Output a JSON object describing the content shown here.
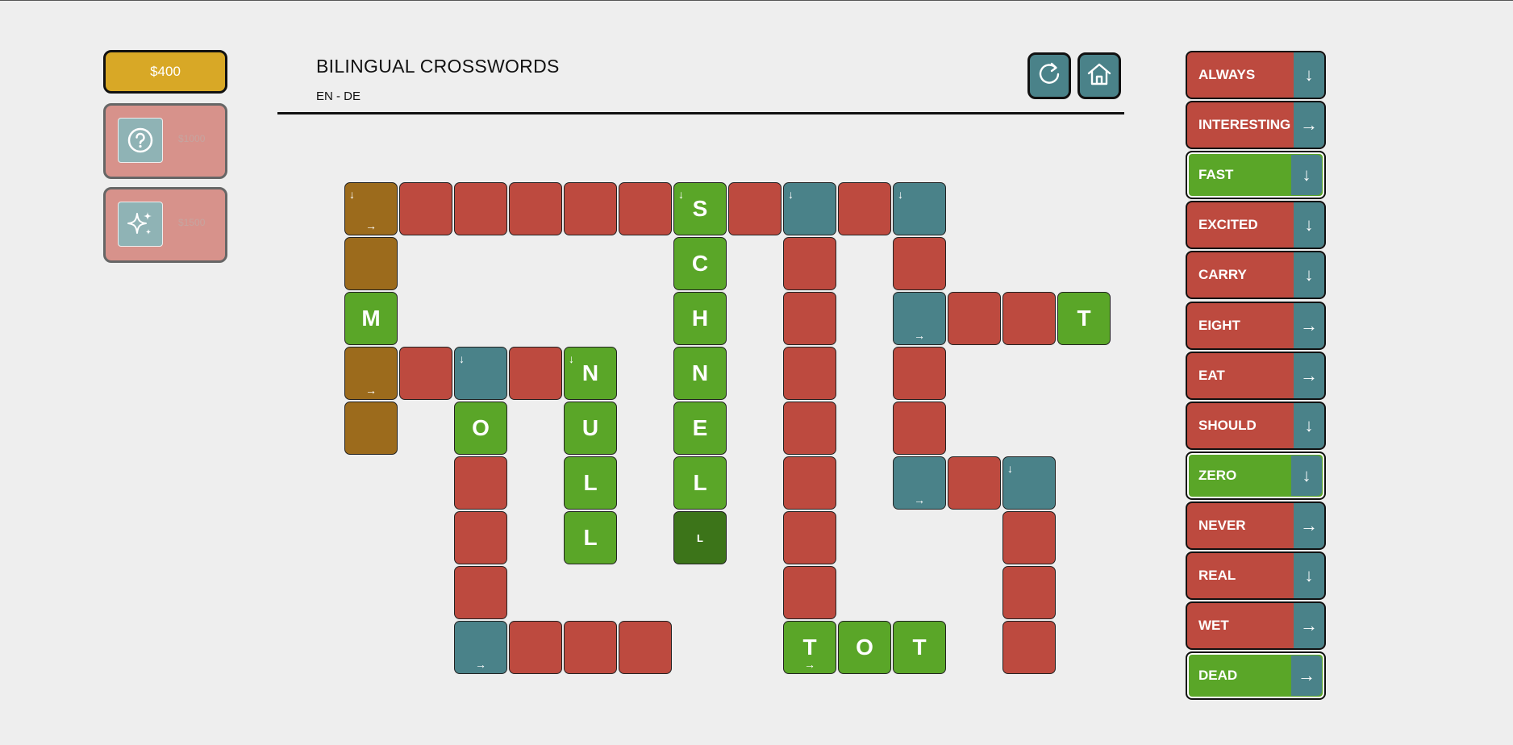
{
  "header": {
    "title": "BILINGUAL CROSSWORDS",
    "subtitle": "EN - DE"
  },
  "money": {
    "label": "$400"
  },
  "powerups": [
    {
      "icon": "help-circle-icon",
      "cost": "$1000"
    },
    {
      "icon": "sparkle-icon",
      "cost": "$1500"
    }
  ],
  "toolbar": {
    "restart_icon": "refresh-icon",
    "home_icon": "home-icon"
  },
  "colors": {
    "empty": "#bd4a3f",
    "correct": "#5aa628",
    "correct_dark": "#3c7419",
    "start": "#4a8289",
    "active": "#9c6b1c",
    "money": "#d8a826"
  },
  "grid": {
    "cells": [
      {
        "c": 0,
        "r": 0,
        "s": "active",
        "l": "",
        "d": true,
        "a": true
      },
      {
        "c": 1,
        "r": 0,
        "s": "empty",
        "l": ""
      },
      {
        "c": 2,
        "r": 0,
        "s": "empty",
        "l": ""
      },
      {
        "c": 3,
        "r": 0,
        "s": "empty",
        "l": ""
      },
      {
        "c": 4,
        "r": 0,
        "s": "empty",
        "l": ""
      },
      {
        "c": 5,
        "r": 0,
        "s": "empty",
        "l": ""
      },
      {
        "c": 6,
        "r": 0,
        "s": "correct",
        "l": "S",
        "d": true
      },
      {
        "c": 7,
        "r": 0,
        "s": "empty",
        "l": ""
      },
      {
        "c": 8,
        "r": 0,
        "s": "start",
        "l": "",
        "d": true
      },
      {
        "c": 9,
        "r": 0,
        "s": "empty",
        "l": ""
      },
      {
        "c": 10,
        "r": 0,
        "s": "start",
        "l": "",
        "d": true
      },
      {
        "c": 0,
        "r": 1,
        "s": "active",
        "l": ""
      },
      {
        "c": 6,
        "r": 1,
        "s": "correct",
        "l": "C"
      },
      {
        "c": 8,
        "r": 1,
        "s": "empty",
        "l": ""
      },
      {
        "c": 10,
        "r": 1,
        "s": "empty",
        "l": ""
      },
      {
        "c": 0,
        "r": 2,
        "s": "correct",
        "l": "M"
      },
      {
        "c": 6,
        "r": 2,
        "s": "correct",
        "l": "H"
      },
      {
        "c": 8,
        "r": 2,
        "s": "empty",
        "l": ""
      },
      {
        "c": 10,
        "r": 2,
        "s": "start",
        "l": "",
        "a": true
      },
      {
        "c": 11,
        "r": 2,
        "s": "empty",
        "l": ""
      },
      {
        "c": 12,
        "r": 2,
        "s": "empty",
        "l": ""
      },
      {
        "c": 13,
        "r": 2,
        "s": "correct",
        "l": "T"
      },
      {
        "c": 0,
        "r": 3,
        "s": "active",
        "l": "",
        "a": true
      },
      {
        "c": 1,
        "r": 3,
        "s": "empty",
        "l": ""
      },
      {
        "c": 2,
        "r": 3,
        "s": "start",
        "l": "",
        "d": true
      },
      {
        "c": 3,
        "r": 3,
        "s": "empty",
        "l": ""
      },
      {
        "c": 4,
        "r": 3,
        "s": "correct",
        "l": "N",
        "d": true
      },
      {
        "c": 6,
        "r": 3,
        "s": "correct",
        "l": "N"
      },
      {
        "c": 8,
        "r": 3,
        "s": "empty",
        "l": ""
      },
      {
        "c": 10,
        "r": 3,
        "s": "empty",
        "l": ""
      },
      {
        "c": 0,
        "r": 4,
        "s": "active",
        "l": ""
      },
      {
        "c": 2,
        "r": 4,
        "s": "correct",
        "l": "O"
      },
      {
        "c": 4,
        "r": 4,
        "s": "correct",
        "l": "U"
      },
      {
        "c": 6,
        "r": 4,
        "s": "correct",
        "l": "E"
      },
      {
        "c": 8,
        "r": 4,
        "s": "empty",
        "l": ""
      },
      {
        "c": 10,
        "r": 4,
        "s": "empty",
        "l": ""
      },
      {
        "c": 2,
        "r": 5,
        "s": "empty",
        "l": ""
      },
      {
        "c": 4,
        "r": 5,
        "s": "correct",
        "l": "L"
      },
      {
        "c": 6,
        "r": 5,
        "s": "correct",
        "l": "L"
      },
      {
        "c": 8,
        "r": 5,
        "s": "empty",
        "l": ""
      },
      {
        "c": 10,
        "r": 5,
        "s": "start",
        "l": "",
        "a": true
      },
      {
        "c": 11,
        "r": 5,
        "s": "empty",
        "l": ""
      },
      {
        "c": 12,
        "r": 5,
        "s": "start",
        "l": "",
        "d": true
      },
      {
        "c": 2,
        "r": 6,
        "s": "empty",
        "l": ""
      },
      {
        "c": 4,
        "r": 6,
        "s": "correct",
        "l": "L"
      },
      {
        "c": 6,
        "r": 6,
        "s": "correct_dark",
        "l": "L",
        "small": true
      },
      {
        "c": 8,
        "r": 6,
        "s": "empty",
        "l": ""
      },
      {
        "c": 12,
        "r": 6,
        "s": "empty",
        "l": ""
      },
      {
        "c": 2,
        "r": 7,
        "s": "empty",
        "l": ""
      },
      {
        "c": 8,
        "r": 7,
        "s": "empty",
        "l": ""
      },
      {
        "c": 12,
        "r": 7,
        "s": "empty",
        "l": ""
      },
      {
        "c": 2,
        "r": 8,
        "s": "start",
        "l": "",
        "a": true
      },
      {
        "c": 3,
        "r": 8,
        "s": "empty",
        "l": ""
      },
      {
        "c": 4,
        "r": 8,
        "s": "empty",
        "l": ""
      },
      {
        "c": 5,
        "r": 8,
        "s": "empty",
        "l": ""
      },
      {
        "c": 8,
        "r": 8,
        "s": "correct",
        "l": "T",
        "a": true
      },
      {
        "c": 9,
        "r": 8,
        "s": "correct",
        "l": "O"
      },
      {
        "c": 10,
        "r": 8,
        "s": "correct",
        "l": "T"
      },
      {
        "c": 12,
        "r": 8,
        "s": "empty",
        "l": ""
      }
    ]
  },
  "clues": [
    {
      "label": "ALWAYS",
      "dir": "↓",
      "state": "empty"
    },
    {
      "label": "INTERESTING",
      "dir": "→",
      "state": "empty"
    },
    {
      "label": "FAST",
      "dir": "↓",
      "state": "solved"
    },
    {
      "label": "EXCITED",
      "dir": "↓",
      "state": "empty"
    },
    {
      "label": "CARRY",
      "dir": "↓",
      "state": "empty"
    },
    {
      "label": "EIGHT",
      "dir": "→",
      "state": "empty"
    },
    {
      "label": "EAT",
      "dir": "→",
      "state": "empty"
    },
    {
      "label": "SHOULD",
      "dir": "↓",
      "state": "empty"
    },
    {
      "label": "ZERO",
      "dir": "↓",
      "state": "solved"
    },
    {
      "label": "NEVER",
      "dir": "→",
      "state": "empty"
    },
    {
      "label": "REAL",
      "dir": "↓",
      "state": "empty"
    },
    {
      "label": "WET",
      "dir": "→",
      "state": "empty"
    },
    {
      "label": "DEAD",
      "dir": "→",
      "state": "solved"
    }
  ]
}
